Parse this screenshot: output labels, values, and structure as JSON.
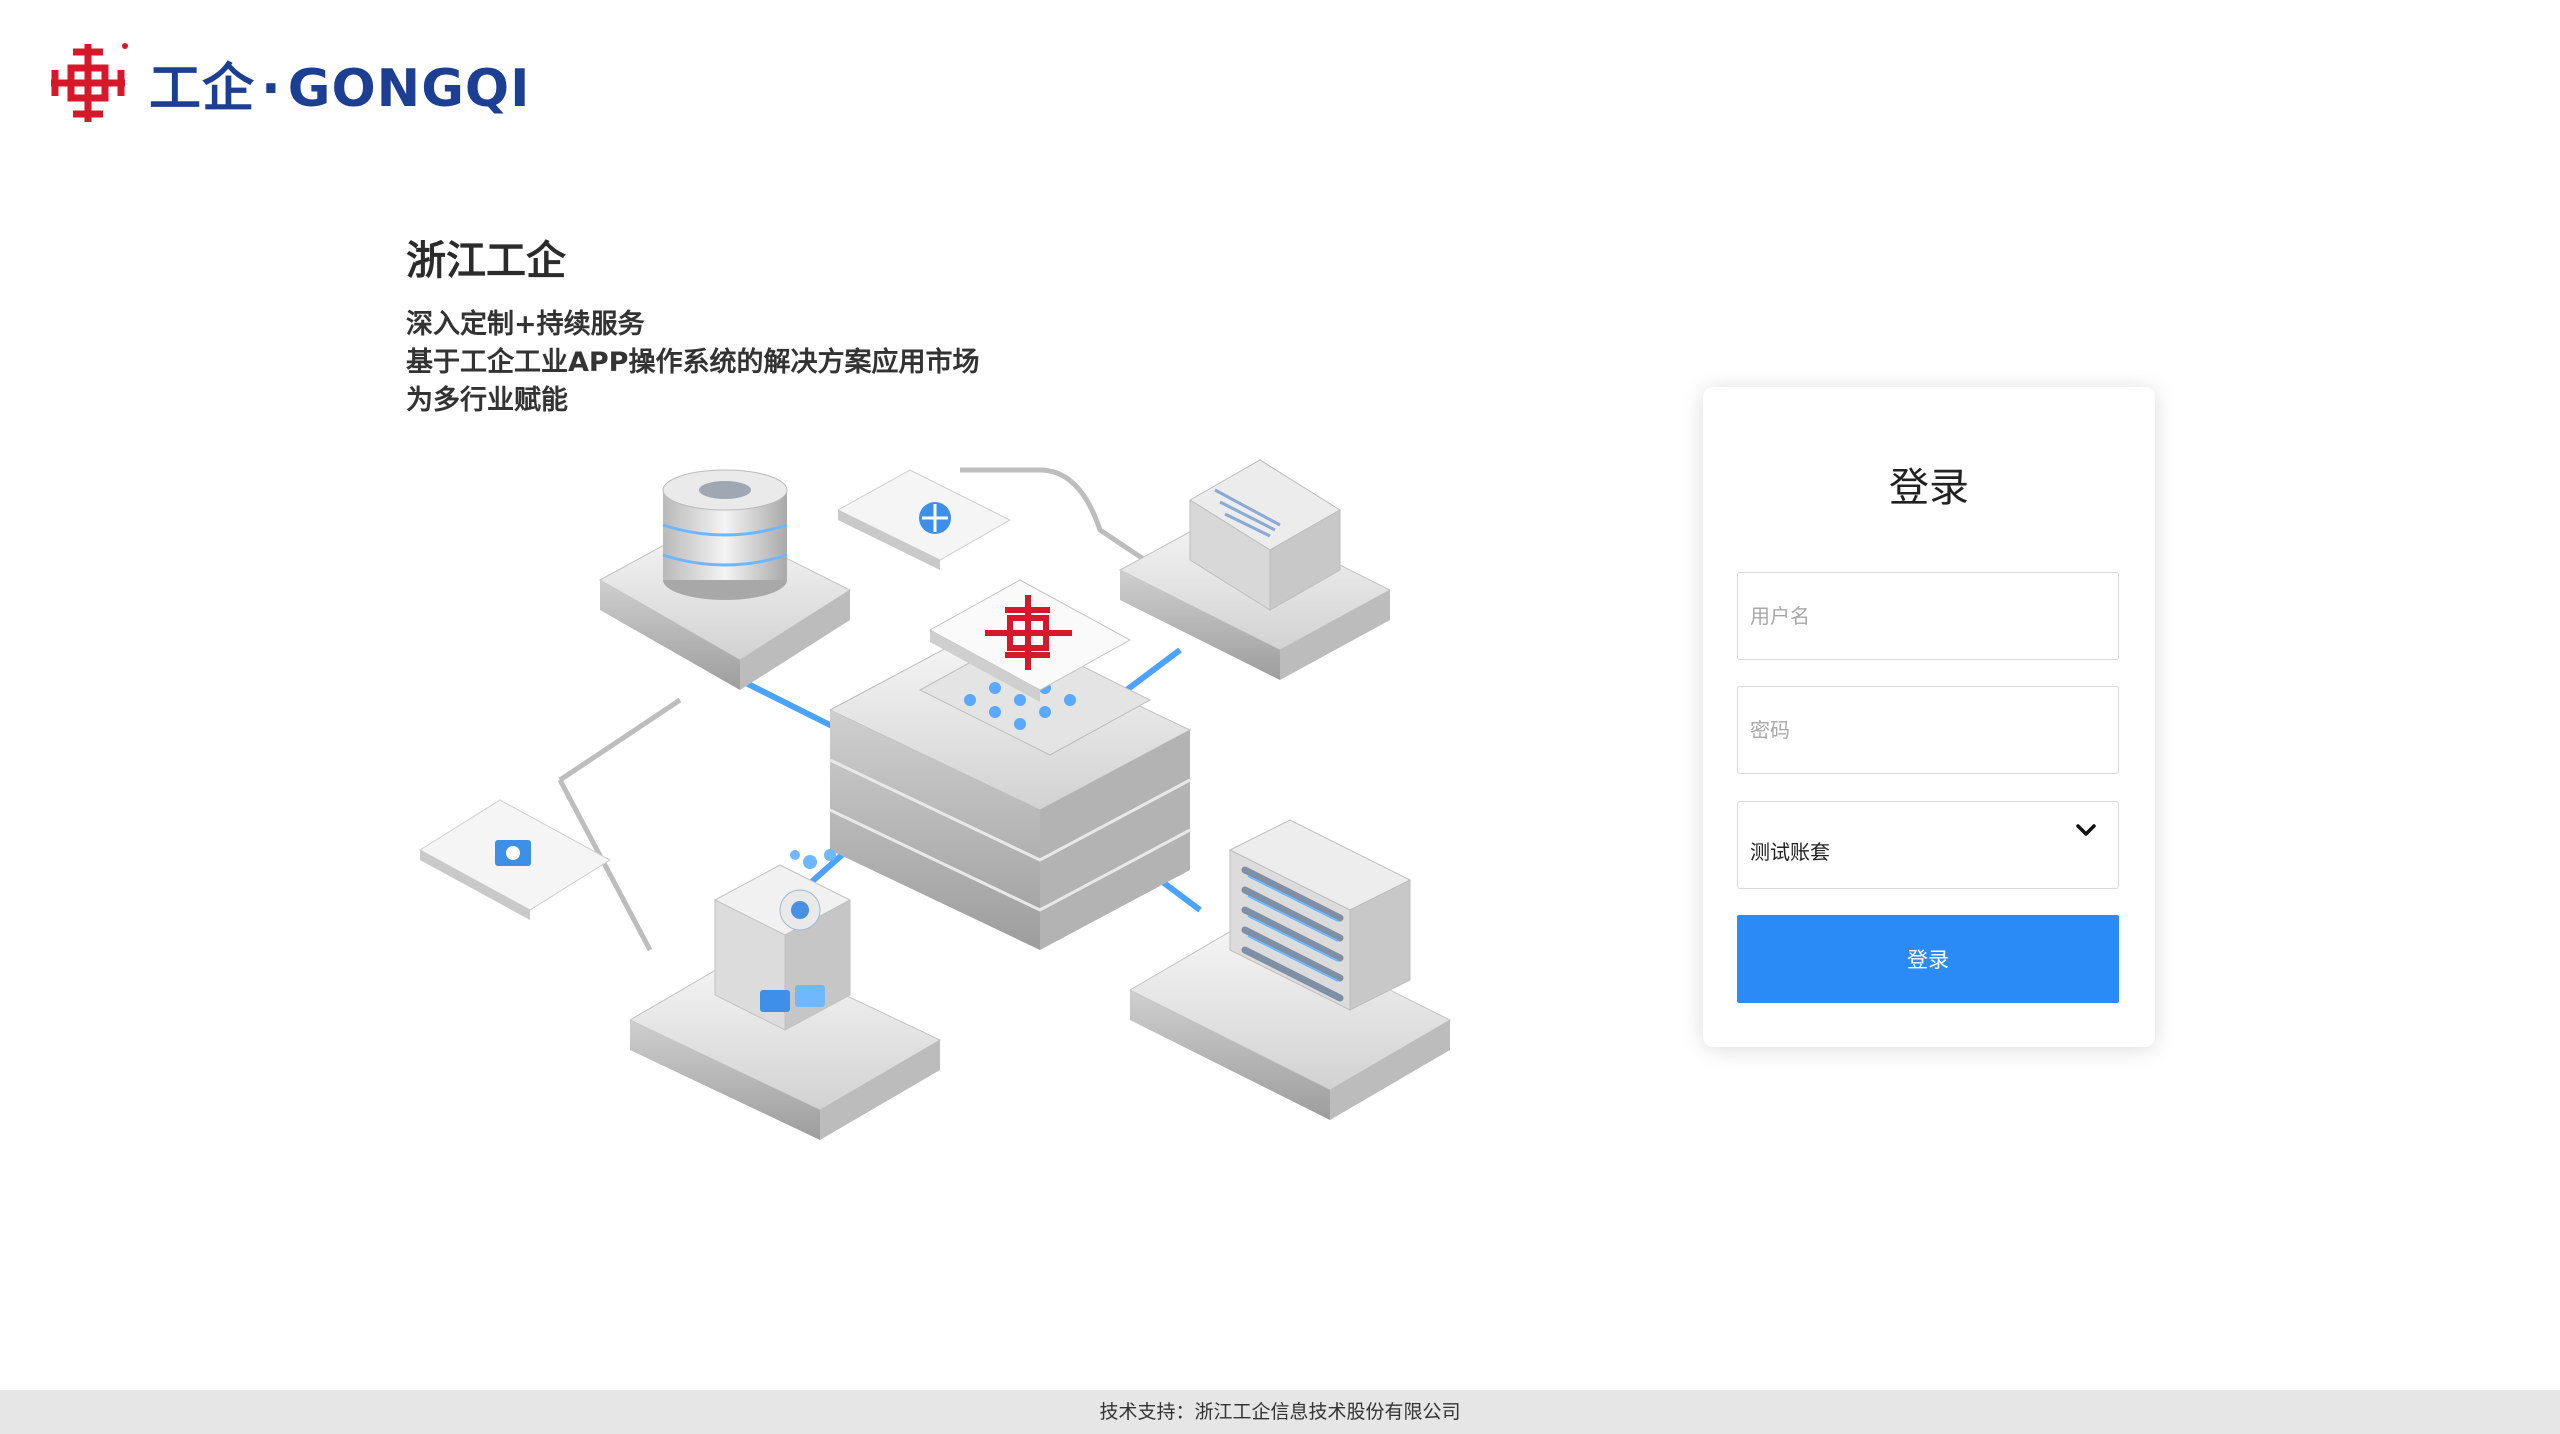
{
  "brand": {
    "name": "工企",
    "dot": "·",
    "latin": "GONGQI",
    "color_red": "#d7182a",
    "color_blue": "#1c3f94"
  },
  "intro": {
    "title": "浙江工企",
    "lines": [
      "深入定制+持续服务",
      "基于工企工业APP操作系统的解决方案应用市场",
      "为多行业赋能"
    ]
  },
  "login": {
    "title": "登录",
    "username_placeholder": "用户名",
    "password_placeholder": "密码",
    "account_selected": "测试账套",
    "submit_label": "登录",
    "accent_color": "#2a8bf7"
  },
  "footer": {
    "text": "技术支持：浙江工企信息技术股份有限公司"
  }
}
